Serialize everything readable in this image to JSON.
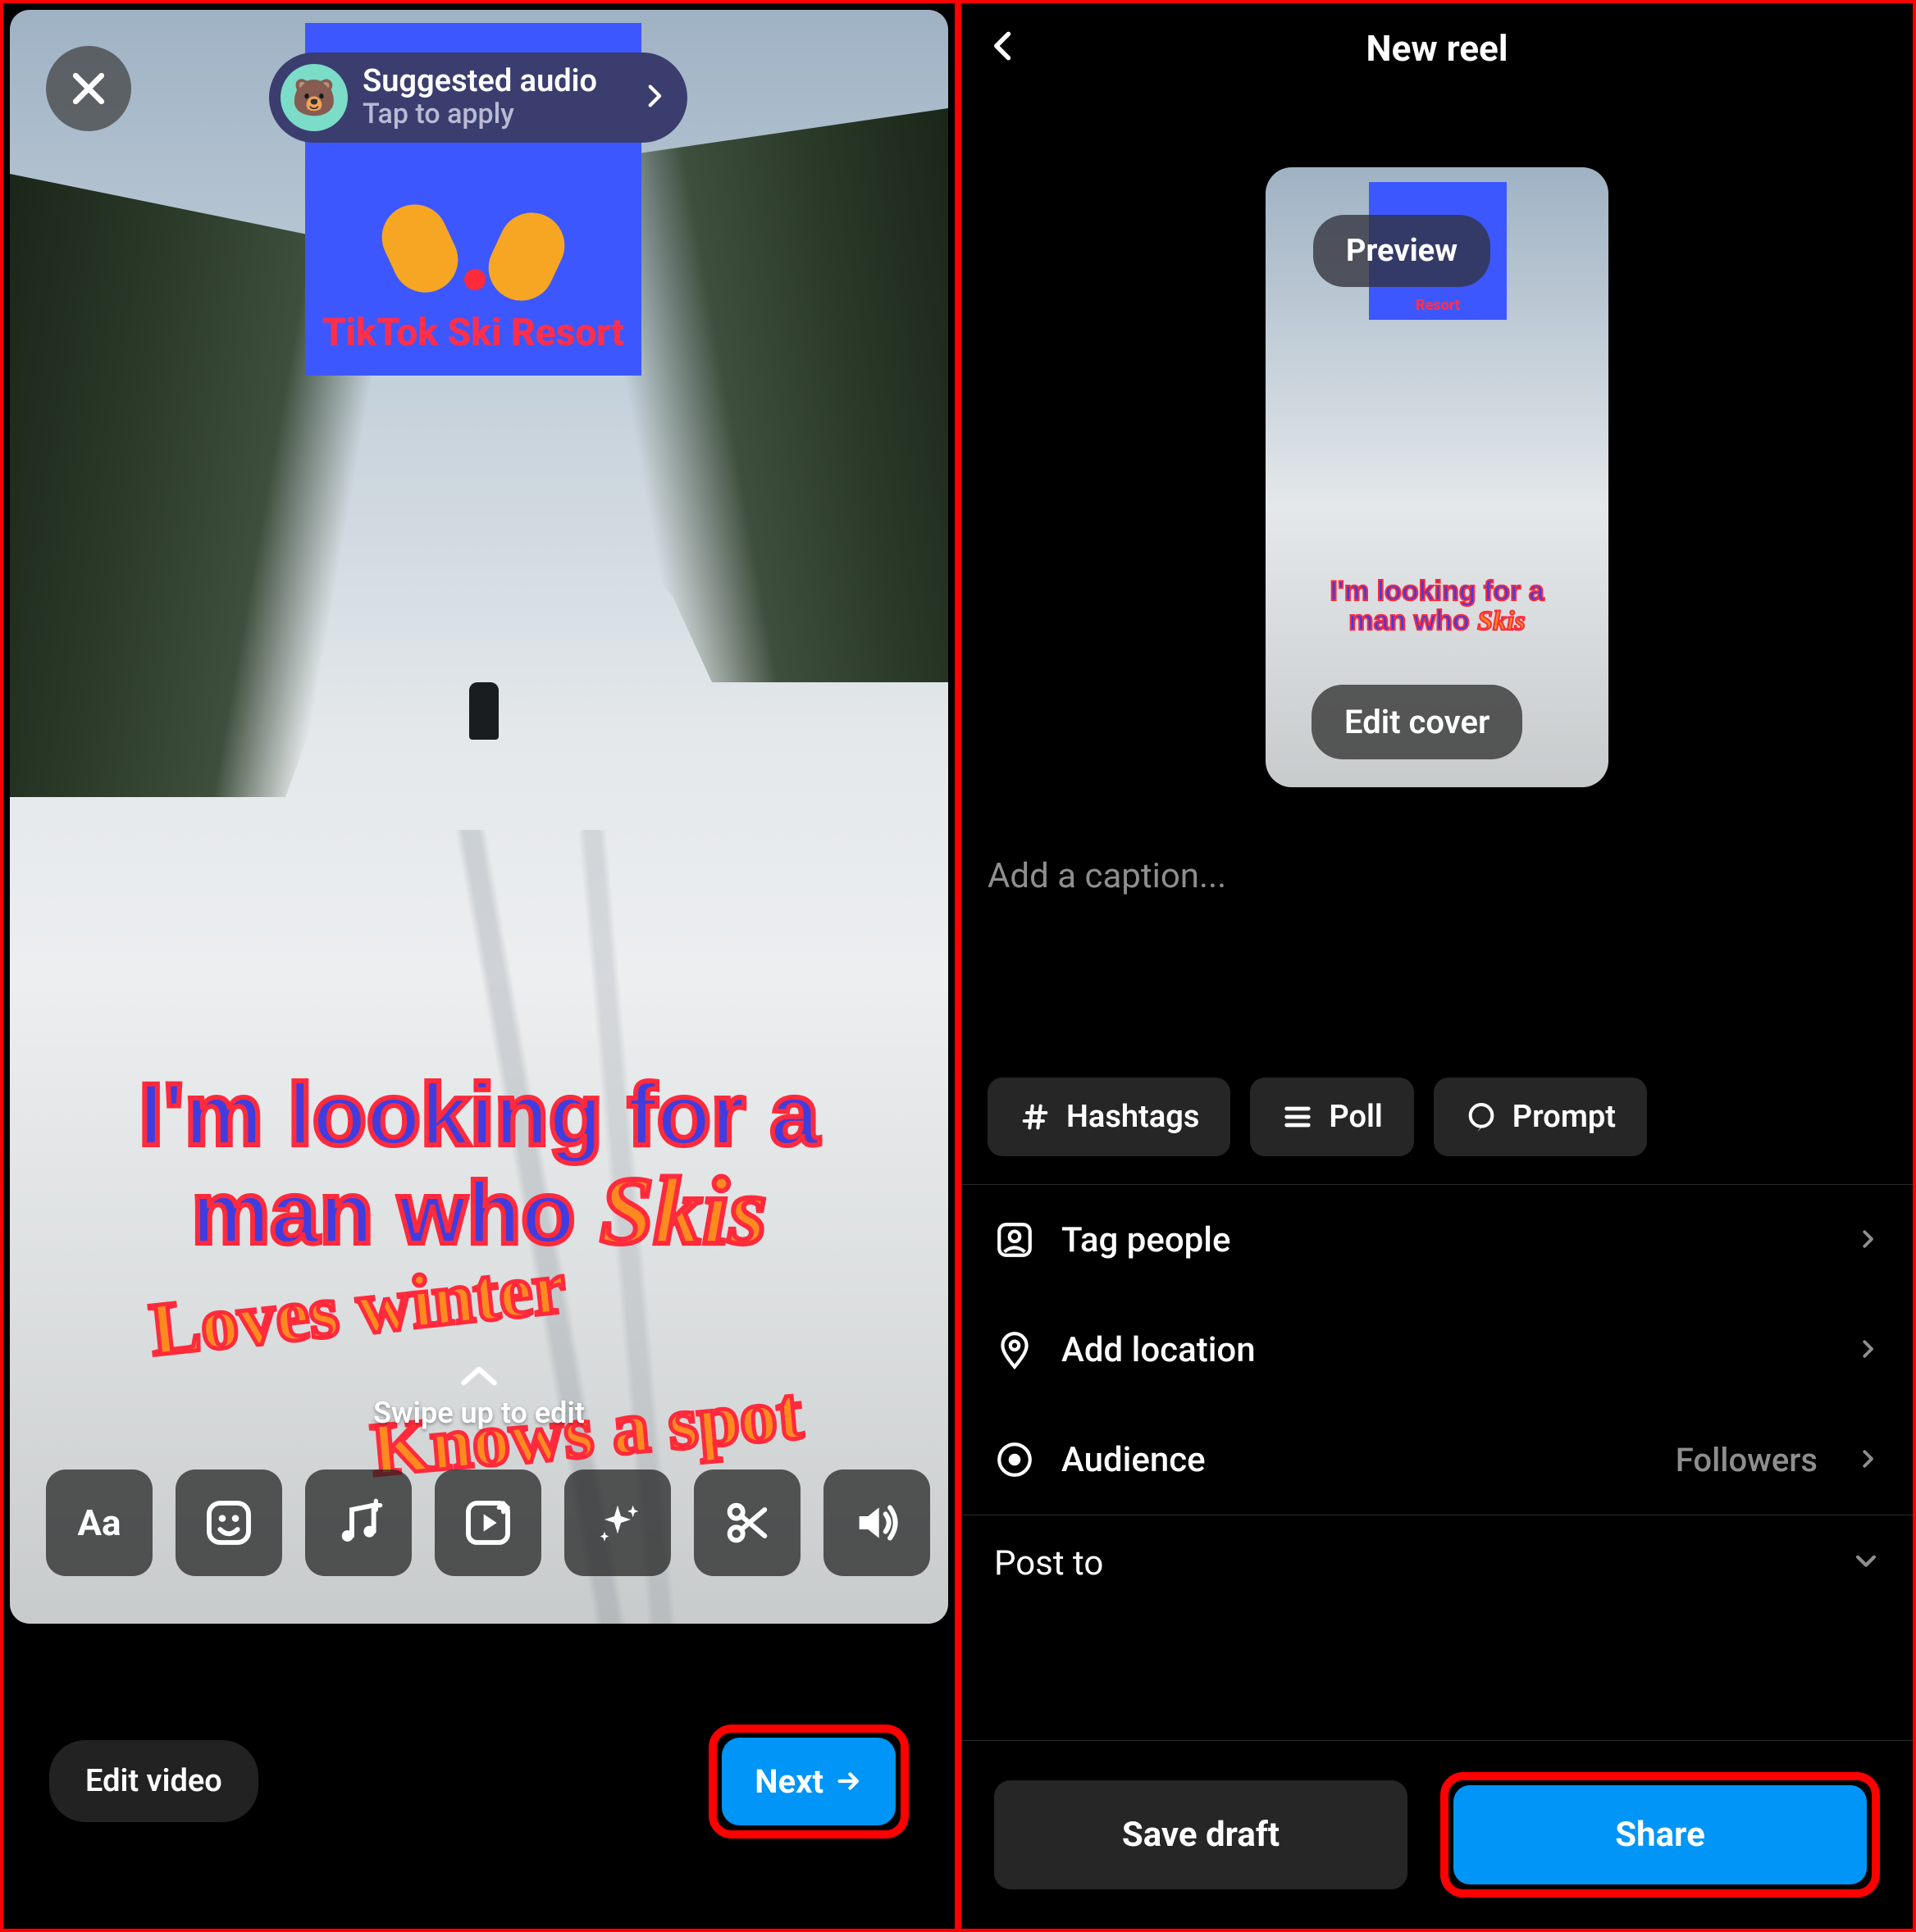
{
  "left": {
    "suggested_audio": {
      "title": "Suggested audio",
      "subtitle": "Tap to apply"
    },
    "tile_title": "TikTok Ski Resort",
    "overlay": {
      "main_line1": "I'm looking for a",
      "main_line2_prefix": "man who ",
      "main_line2_em": "Skis",
      "line2": "Loves winter",
      "line3": "Knows a spot"
    },
    "swipe_hint": "Swipe up to edit",
    "tools": {
      "text": "Aa"
    },
    "edit_video": "Edit video",
    "next": "Next"
  },
  "right": {
    "title": "New reel",
    "preview_label": "Preview",
    "thumb_tile": "Resort",
    "thumb_main_line1": "I'm looking for a",
    "thumb_main_line2_prefix": "man who ",
    "thumb_main_line2_em": "Skis",
    "edit_cover": "Edit cover",
    "caption_placeholder": "Add a caption...",
    "chips": {
      "hashtags": "Hashtags",
      "poll": "Poll",
      "prompt": "Prompt"
    },
    "rows": {
      "tag_people": "Tag people",
      "add_location": "Add location",
      "audience": "Audience",
      "audience_value": "Followers",
      "post_to": "Post to"
    },
    "save_draft": "Save draft",
    "share": "Share"
  }
}
